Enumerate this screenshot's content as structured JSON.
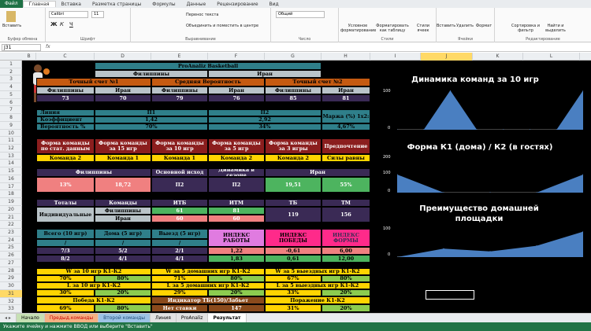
{
  "ribbon_tabs": {
    "file": "Файл",
    "items": [
      "Главная",
      "Вставка",
      "Разметка страницы",
      "Формулы",
      "Данные",
      "Рецензирование",
      "Вид"
    ]
  },
  "ribbon": {
    "paste": "Вставить",
    "clipboard": "Буфер обмена",
    "font_name": "Calibri",
    "font_size": "11",
    "font_group": "Шрифт",
    "wrap_text": "Перенос текста",
    "merge_center": "Объединить и поместить в центре",
    "align_group": "Выравнивание",
    "number_format": "Общий",
    "number_group": "Число",
    "cond_format": "Условное форматирование",
    "format_table": "Форматировать как таблицу",
    "cell_styles": "Стили ячеек",
    "styles_group": "Стили",
    "insert": "Вставить",
    "delete": "Удалить",
    "format": "Формат",
    "cells_group": "Ячейки",
    "sort_filter": "Сортировка и фильтр",
    "find_select": "Найти и выделить",
    "edit_group": "Редактирование"
  },
  "formula_bar": {
    "name_box": "J31",
    "fx": "fx"
  },
  "columns": [
    "B",
    "C",
    "D",
    "E",
    "F",
    "G",
    "H",
    "I",
    "J",
    "K",
    "L"
  ],
  "rows": [
    "1",
    "2",
    "3",
    "4",
    "5",
    "6",
    "7",
    "8",
    "9",
    "10",
    "11",
    "12",
    "13",
    "14",
    "15",
    "16",
    "17",
    "18",
    "19",
    "20",
    "21",
    "22",
    "23",
    "24",
    "25",
    "26",
    "27",
    "28",
    "29",
    "30",
    "31",
    "32",
    "33"
  ],
  "header": {
    "title": "ProAnaliz Basketball",
    "team1": "Филиппины",
    "team2": "Иран"
  },
  "exact": {
    "t1": "Точный счет №1",
    "mid": "Средняя Вероятность",
    "t2": "Точный счет №2",
    "h": [
      "Филиппины",
      "Иран",
      "Филиппины",
      "Иран",
      "Филиппины",
      "Иран"
    ],
    "v": [
      "73",
      "70",
      "79",
      "76",
      "85",
      "81"
    ]
  },
  "line": {
    "l1": "Линия",
    "l2": "Коэффициент",
    "l3": "Вероятность %",
    "p1": "П1",
    "p2": "П2",
    "k1": "1,42",
    "k2": "2,92",
    "pr1": "70%",
    "pr2": "34%",
    "margin_label": "Маржа (%) 1x2:",
    "margin_value": "4,67%"
  },
  "form": {
    "h": [
      "Форма команды по стат. данным",
      "Форма команды за 15 игр",
      "Форма команды за 10 игр",
      "Форма команды за 5 игр",
      "Форма команды за 3 игры",
      "Предпочтение"
    ],
    "v": [
      "Команда 2",
      "Команда 1",
      "Команда 1",
      "Команда 2",
      "Команда 2",
      "Силы равны"
    ]
  },
  "exodus": {
    "h": [
      "Филиппины",
      "Основной исход",
      "Динамика в сезоне",
      "Иран"
    ],
    "v": [
      "13%",
      "18,72",
      "П2",
      "П2",
      "19,51",
      "55%"
    ]
  },
  "totals": {
    "h1": "Тоталы",
    "h2": "Команды",
    "h3": "ИТБ",
    "h4": "ИТМ",
    "h5": "ТБ",
    "h6": "ТМ",
    "label": "Индивидуальные",
    "team1": "Филиппины",
    "team2": "Иран",
    "itb1": "61",
    "itb2": "60",
    "itm1": "81",
    "itm2": "60",
    "tb": "119",
    "tm": "156"
  },
  "games": {
    "h": [
      "Всего (10 игр)",
      "Дома (5 игр)",
      "Выезд (5 игр)",
      "ИНДЕКС РАБОТЫ",
      "ИНДЕКС ПОБЕДЫ",
      "ИНДЕКС ФОРМЫ"
    ],
    "sub": [
      "/",
      "/",
      "/"
    ],
    "r1": [
      "7/3",
      "5/2",
      "2/1",
      "1,22",
      "-0,61",
      "6,00"
    ],
    "r2": [
      "8/2",
      "4/1",
      "4/1",
      "1,83",
      "0,61",
      "12,00"
    ]
  },
  "wins": {
    "h": [
      "W за 10 игр К1-К2",
      "W за 5 домашних игр К1-К2",
      "W за 5 выездных игр К1-К2"
    ],
    "v": [
      "70%",
      "80%",
      "71%",
      "80%",
      "67%",
      "80%"
    ],
    "h2": [
      "L за 10 игр К1-К2",
      "L за 5 домашних игр К1-К2",
      "L за 5 выездных игр К1-К2"
    ],
    "v2": [
      "30%",
      "20%",
      "29%",
      "20%",
      "33%",
      "20%"
    ],
    "h3": [
      "Победа К1-К2",
      "Индикатор ТБ(150)/Забьет",
      "Поражение К1-К2"
    ],
    "v3": [
      "69%",
      "80%",
      "Нет ставки",
      "147",
      "31%",
      "20%"
    ]
  },
  "charts": {
    "c1_title": "Динамика команд за 10 игр",
    "c2_title": "Форма К1 (дома) / К2 (в гостях)",
    "c3_title": "Преимущество домашней площадки",
    "axis": {
      "top": "100",
      "bottom": "0",
      "top2": "200"
    }
  },
  "chart_data": [
    {
      "type": "area",
      "title": "Динамика команд за 10 игр",
      "values": [
        0,
        0,
        100,
        0,
        0,
        0,
        0,
        100
      ],
      "ylim": [
        0,
        100
      ]
    },
    {
      "type": "area",
      "title": "Форма К1 (дома) / К2 (в гостях)",
      "values": [
        100,
        0,
        0,
        0,
        100
      ],
      "ylim": [
        0,
        200
      ]
    },
    {
      "type": "area",
      "title": "Преимущество домашней площадки",
      "values": [
        0,
        30,
        20,
        40,
        90
      ],
      "ylim": [
        0,
        100
      ]
    }
  ],
  "sheet_tabs": [
    "Начало",
    "Предыд.команды",
    "Второй команды",
    "Линия",
    "ProAnaliz",
    "Результат"
  ],
  "status": "Укажите ячейку и нажмите ВВОД или выберите \"Вставить\"",
  "colors": {
    "accent": "#217346",
    "chart_fill": "#4a7fc1"
  }
}
